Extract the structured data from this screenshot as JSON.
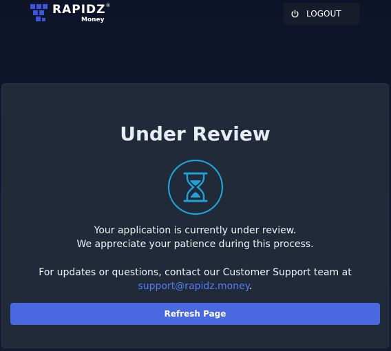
{
  "header": {
    "brand": "RAPIDZ",
    "registered": "®",
    "sub": "Money",
    "logout_label": "LOGOUT",
    "logout_icon": "power-icon"
  },
  "review": {
    "title": "Under Review",
    "icon": "hourglass-icon",
    "line1": "Your application is currently under review.",
    "line2": "We appreciate your patience during this process.",
    "line3": "For updates or questions, contact our Customer Support team at",
    "email": "support@rapidz.money",
    "email_suffix": ".",
    "refresh_label": "Refresh Page"
  },
  "colors": {
    "accent": "#4a68e0",
    "link": "#5b7cf6",
    "icon": "#1fa3d6",
    "card": "#202a39"
  }
}
